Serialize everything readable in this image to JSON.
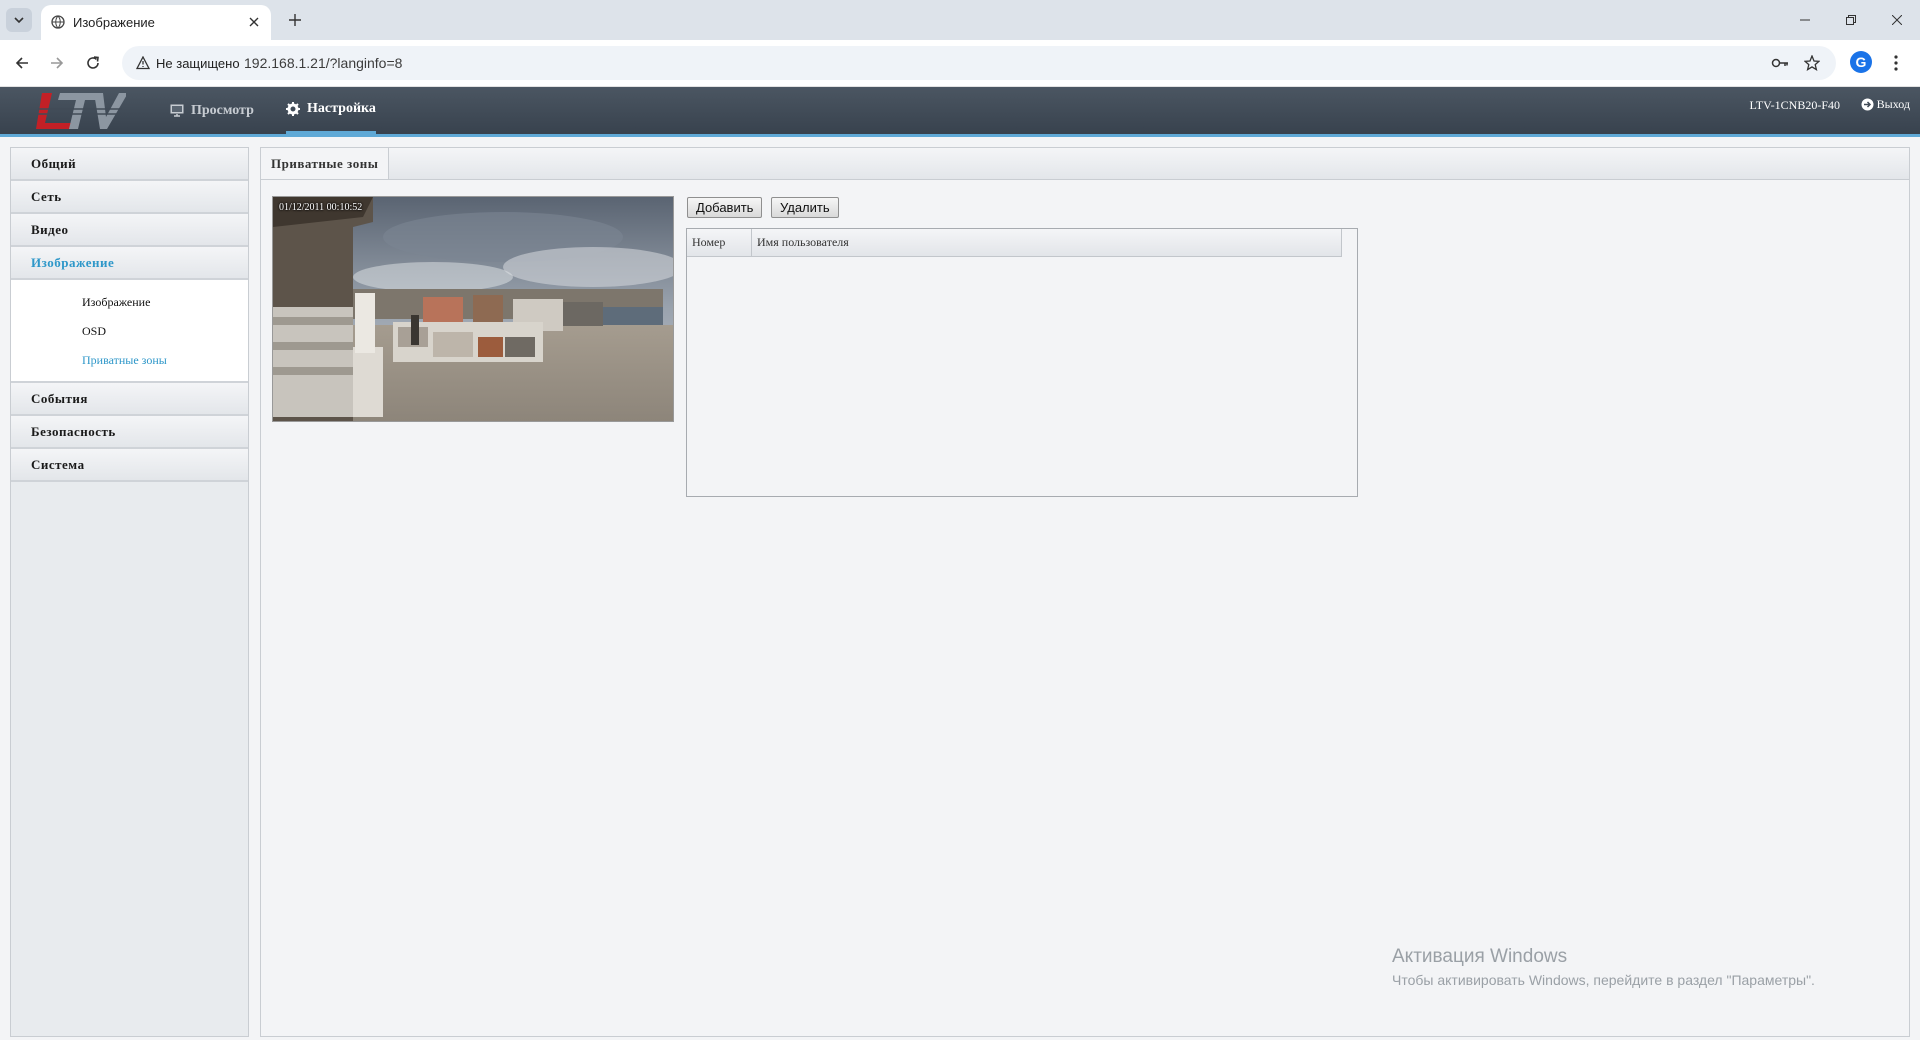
{
  "browser": {
    "tab_title": "Изображение",
    "security_label": "Не защищено",
    "url": "192.168.1.21/?langinfo=8"
  },
  "header": {
    "nav": [
      {
        "label": "Просмотр",
        "icon": "monitor-icon"
      },
      {
        "label": "Настройка",
        "icon": "gear-icon"
      }
    ],
    "device_name": "LTV-1CNB20-F40",
    "logout_label": "Выход"
  },
  "sidebar": {
    "sections": [
      "Общий",
      "Сеть",
      "Видео",
      "Изображение",
      "События",
      "Безопасность",
      "Система"
    ],
    "image_subitems": [
      "Изображение",
      "OSD",
      "Приватные зоны"
    ]
  },
  "content": {
    "tab_title": "Приватные зоны",
    "osd_timestamp": "01/12/2011 00:10:52",
    "add_button": "Добавить",
    "delete_button": "Удалить",
    "table_headers": [
      "Номер",
      "Имя пользователя"
    ]
  },
  "watermark": {
    "title": "Активация Windows",
    "subtitle": "Чтобы активировать Windows, перейдите в раздел \"Параметры\"."
  },
  "colors": {
    "header_bg": "#414b57",
    "accent": "#2e97c9"
  }
}
